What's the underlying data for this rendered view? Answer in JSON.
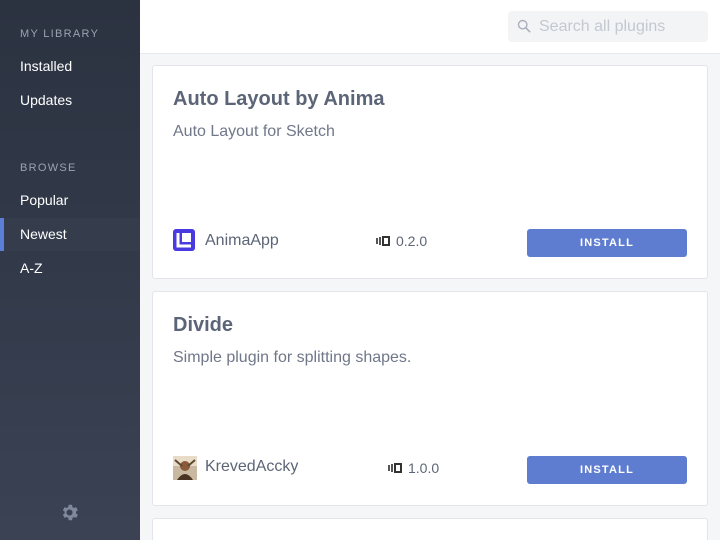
{
  "sidebar": {
    "library_title": "MY LIBRARY",
    "library_items": [
      {
        "label": "Installed"
      },
      {
        "label": "Updates"
      }
    ],
    "browse_title": "BROWSE",
    "browse_items": [
      {
        "label": "Popular"
      },
      {
        "label": "Newest",
        "active": true
      },
      {
        "label": "A-Z"
      }
    ],
    "settings_icon": "gear-icon"
  },
  "search": {
    "placeholder": "Search all plugins",
    "value": "",
    "icon": "search-icon"
  },
  "plugins": [
    {
      "title": "Auto Layout by Anima",
      "description": "Auto Layout for Sketch",
      "author": "AnimaApp",
      "author_avatar": "anima-logo",
      "version": "0.2.0",
      "install_label": "INSTALL"
    },
    {
      "title": "Divide",
      "description": "Simple plugin for splitting shapes.",
      "author": "KrevedAccky",
      "author_avatar": "user-photo",
      "version": "1.0.0",
      "install_label": "INSTALL"
    }
  ],
  "colors": {
    "sidebar_bg": "#2b3240",
    "accent": "#5f7dd0",
    "anima_brand": "#4a3be0"
  }
}
